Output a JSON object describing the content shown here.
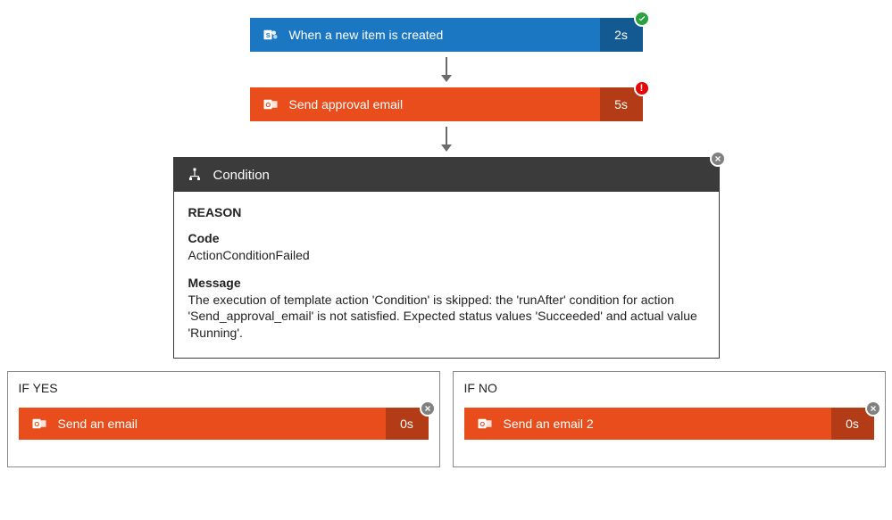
{
  "steps": {
    "trigger": {
      "label": "When a new item is created",
      "duration": "2s"
    },
    "approval": {
      "label": "Send approval email",
      "duration": "5s"
    }
  },
  "condition": {
    "title": "Condition",
    "reason_label": "REASON",
    "code_label": "Code",
    "code_value": "ActionConditionFailed",
    "message_label": "Message",
    "message_value": "The execution of template action 'Condition' is skipped: the 'runAfter' condition for action 'Send_approval_email' is not satisfied. Expected status values 'Succeeded' and actual value 'Running'."
  },
  "branches": {
    "yes": {
      "label": "IF YES",
      "action": {
        "label": "Send an email",
        "duration": "0s"
      }
    },
    "no": {
      "label": "IF NO",
      "action": {
        "label": "Send an email 2",
        "duration": "0s"
      }
    }
  }
}
